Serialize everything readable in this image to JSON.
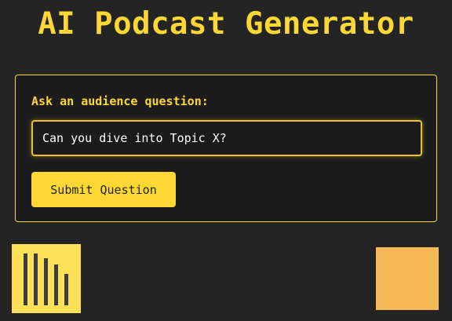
{
  "app": {
    "title": "AI Podcast Generator"
  },
  "question_form": {
    "label": "Ask an audience question:",
    "input_value": "Can you dive into Topic X?",
    "submit_label": "Submit Question"
  },
  "decor": {
    "waveform_icon": "audio-waveform-icon",
    "square_icon": "orange-square-icon"
  },
  "colors": {
    "background": "#242424",
    "accent": "#fdd835",
    "card_background": "#1c1c1c",
    "waveform_tile": "#ffe057",
    "orange_tile": "#f6b957"
  }
}
